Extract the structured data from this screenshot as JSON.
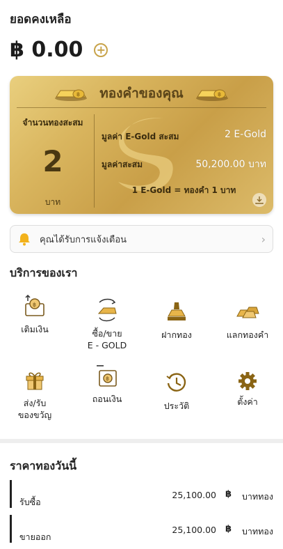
{
  "balance": {
    "title": "ยอดคงเหลือ",
    "amount": "฿ 0.00",
    "add_icon": "plus-circle-icon"
  },
  "gold_card": {
    "title": "ทองคำของคุณ",
    "accumulated_label": "จำนวนทองสะสม",
    "accumulated_value": "2",
    "accumulated_unit": "บาท",
    "egold_label": "มูลค่า E-Gold สะสม",
    "egold_value": "2 E-Gold",
    "total_label": "มูลค่าสะสม",
    "total_value": "50,200.00 บาท",
    "rate": "1 E-Gold = ทองคำ 1 บาท"
  },
  "notification": {
    "text": "คุณได้รับการแจ้งเตือน"
  },
  "services": {
    "title": "บริการของเรา",
    "items": [
      {
        "label": "เติมเงิน",
        "icon": "deposit-icon"
      },
      {
        "label": "ซื้อ/ขาย\nE - GOLD",
        "icon": "buy-sell-icon"
      },
      {
        "label": "ฝากทอง",
        "icon": "deposit-gold-icon"
      },
      {
        "label": "แลกทองคำ",
        "icon": "exchange-gold-icon"
      },
      {
        "label": "ส่ง/รับ\nของขวัญ",
        "icon": "gift-icon"
      },
      {
        "label": "ถอนเงิน",
        "icon": "withdraw-icon"
      },
      {
        "label": "ประวัติ",
        "icon": "history-icon"
      },
      {
        "label": "ตั้งค่า",
        "icon": "settings-icon"
      }
    ]
  },
  "gold_price": {
    "title": "ราคาทองวันนี้",
    "rows": [
      {
        "label": "รับซื้อ",
        "value": "25,100.00",
        "currency": "฿",
        "unit": "บาททอง"
      },
      {
        "label": "ขายออก",
        "value": "25,100.00",
        "currency": "฿",
        "unit": "บาททอง"
      }
    ]
  },
  "colors": {
    "accent": "#c8a34a",
    "gold_dark": "#5a4419"
  }
}
